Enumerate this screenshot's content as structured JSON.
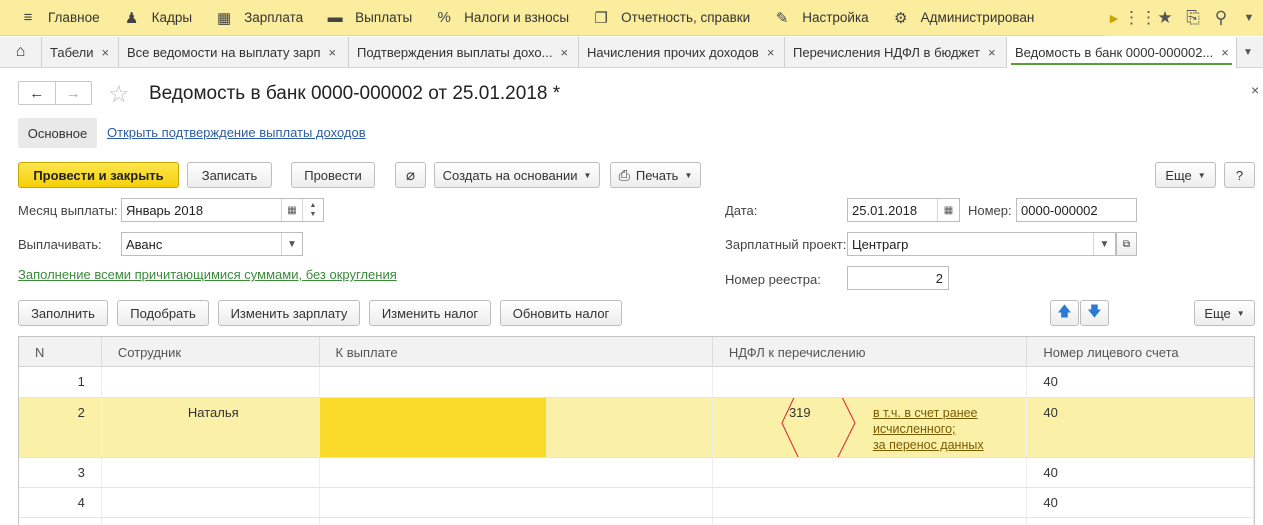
{
  "menu": {
    "items": [
      {
        "icon": "≡",
        "label": "Главное"
      },
      {
        "icon": "♟",
        "label": "Кадры"
      },
      {
        "icon": "▦",
        "label": "Зарплата"
      },
      {
        "icon": "▬",
        "label": "Выплаты"
      },
      {
        "icon": "%",
        "label": "Налоги и взносы"
      },
      {
        "icon": "❐",
        "label": "Отчетность, справки"
      },
      {
        "icon": "✎",
        "label": "Настройка"
      },
      {
        "icon": "⚙",
        "label": "Администрирован"
      }
    ]
  },
  "tabs": [
    {
      "label": "Табели"
    },
    {
      "label": "Все ведомости на выплату зарп"
    },
    {
      "label": "Подтверждения выплаты дохо..."
    },
    {
      "label": "Начисления прочих доходов"
    },
    {
      "label": "Перечисления НДФЛ в бюджет"
    },
    {
      "label": "Ведомость в банк 0000-000002..."
    }
  ],
  "header": {
    "title": "Ведомость в банк 0000-000002 от 25.01.2018 *",
    "subtab_main": "Основное",
    "subtab_link": "Открыть подтверждение выплаты доходов"
  },
  "toolbar": {
    "post_close": "Провести и закрыть",
    "save": "Записать",
    "post": "Провести",
    "create_based": "Создать на основании",
    "print": "Печать",
    "more": "Еще",
    "help": "?"
  },
  "form": {
    "month_label": "Месяц выплаты:",
    "month_value": "Январь 2018",
    "pay_label": "Выплачивать:",
    "pay_value": "Аванс",
    "fill_link": "Заполнение всеми причитающимися суммами, без округления",
    "date_label": "Дата:",
    "date_value": "25.01.2018",
    "number_label": "Номер:",
    "number_value": "0000-000002",
    "project_label": "Зарплатный проект:",
    "project_value": "Центрагр",
    "registry_label": "Номер реестра:",
    "registry_value": "2"
  },
  "table_toolbar": {
    "fill": "Заполнить",
    "pick": "Подобрать",
    "change_salary": "Изменить зарплату",
    "change_tax": "Изменить налог",
    "update_tax": "Обновить налог",
    "more": "Еще"
  },
  "table": {
    "columns": [
      "N",
      "Сотрудник",
      "К выплате",
      "НДФЛ к перечислению",
      "Номер лицевого счета"
    ],
    "rows": [
      {
        "n": "1",
        "employee": "",
        "pay": "",
        "ndfl": "",
        "account": "40"
      },
      {
        "n": "2",
        "employee": "Наталья",
        "pay": "",
        "ndfl": "319",
        "account": "40",
        "ndfl_note": [
          "в т.ч. в счет ранее",
          "исчисленного;",
          "за перенос данных"
        ]
      },
      {
        "n": "3",
        "employee": "",
        "pay": "",
        "ndfl": "",
        "account": "40"
      },
      {
        "n": "4",
        "employee": "",
        "pay": "",
        "ndfl": "",
        "account": "40"
      }
    ]
  },
  "colors": {
    "menu_bg": "#fbed9e",
    "primary_button": "#f5d009",
    "selected_row": "#fbf0a8",
    "pay_cell_highlight": "#fada2a",
    "annotation_hexagon": "#d9232a",
    "link": "#2d5e9e",
    "green_link": "#3a8a3a"
  }
}
